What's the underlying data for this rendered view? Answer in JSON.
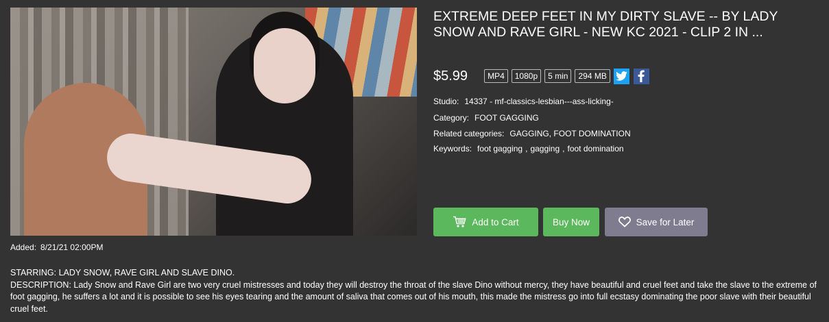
{
  "product": {
    "title": "EXTREME DEEP FEET IN MY DIRTY SLAVE -- BY LADY SNOW AND RAVE GIRL - NEW KC 2021 - CLIP 2 IN ...",
    "price": "$5.99",
    "badges": [
      "MP4",
      "1080p",
      "5 min",
      "294 MB"
    ],
    "added_label": "Added:",
    "added_value": "8/21/21 02:00PM"
  },
  "info": {
    "studio_label": "Studio:",
    "studio_value": "14337 - mf-classics-lesbian---ass-licking-",
    "category_label": "Category:",
    "category_value": "FOOT GAGGING",
    "related_label": "Related categories:",
    "related_values": [
      "GAGGING",
      "FOOT DOMINATION"
    ],
    "keywords_label": "Keywords:",
    "keywords_values": [
      "foot gagging",
      "gagging",
      "foot domination"
    ]
  },
  "actions": {
    "add_to_cart": "Add to Cart",
    "buy_now": "Buy Now",
    "save_for_later": "Save for Later"
  },
  "social": {
    "twitter_icon": "twitter-icon",
    "facebook_icon": "facebook-icon"
  },
  "description": {
    "starring": "STARRING: LADY SNOW, RAVE GIRL AND SLAVE DINO.",
    "text": "DESCRIPTION: Lady Snow and Rave Girl are two very cruel mistresses and today they will destroy the throat of the slave Dino without mercy, they have beautiful and cruel feet and take the slave to the extreme of foot gagging, he suffers a lot and it is possible to see his eyes tearing and the amount of saliva that comes out of his mouth, this made the mistress go into full ecstasy dominating the poor slave with their beautiful cruel feet."
  },
  "colors": {
    "background": "#333333",
    "green": "#5cb85c",
    "save": "#7f7c8f",
    "twitter": "#1da1f2",
    "facebook": "#3b5998"
  }
}
